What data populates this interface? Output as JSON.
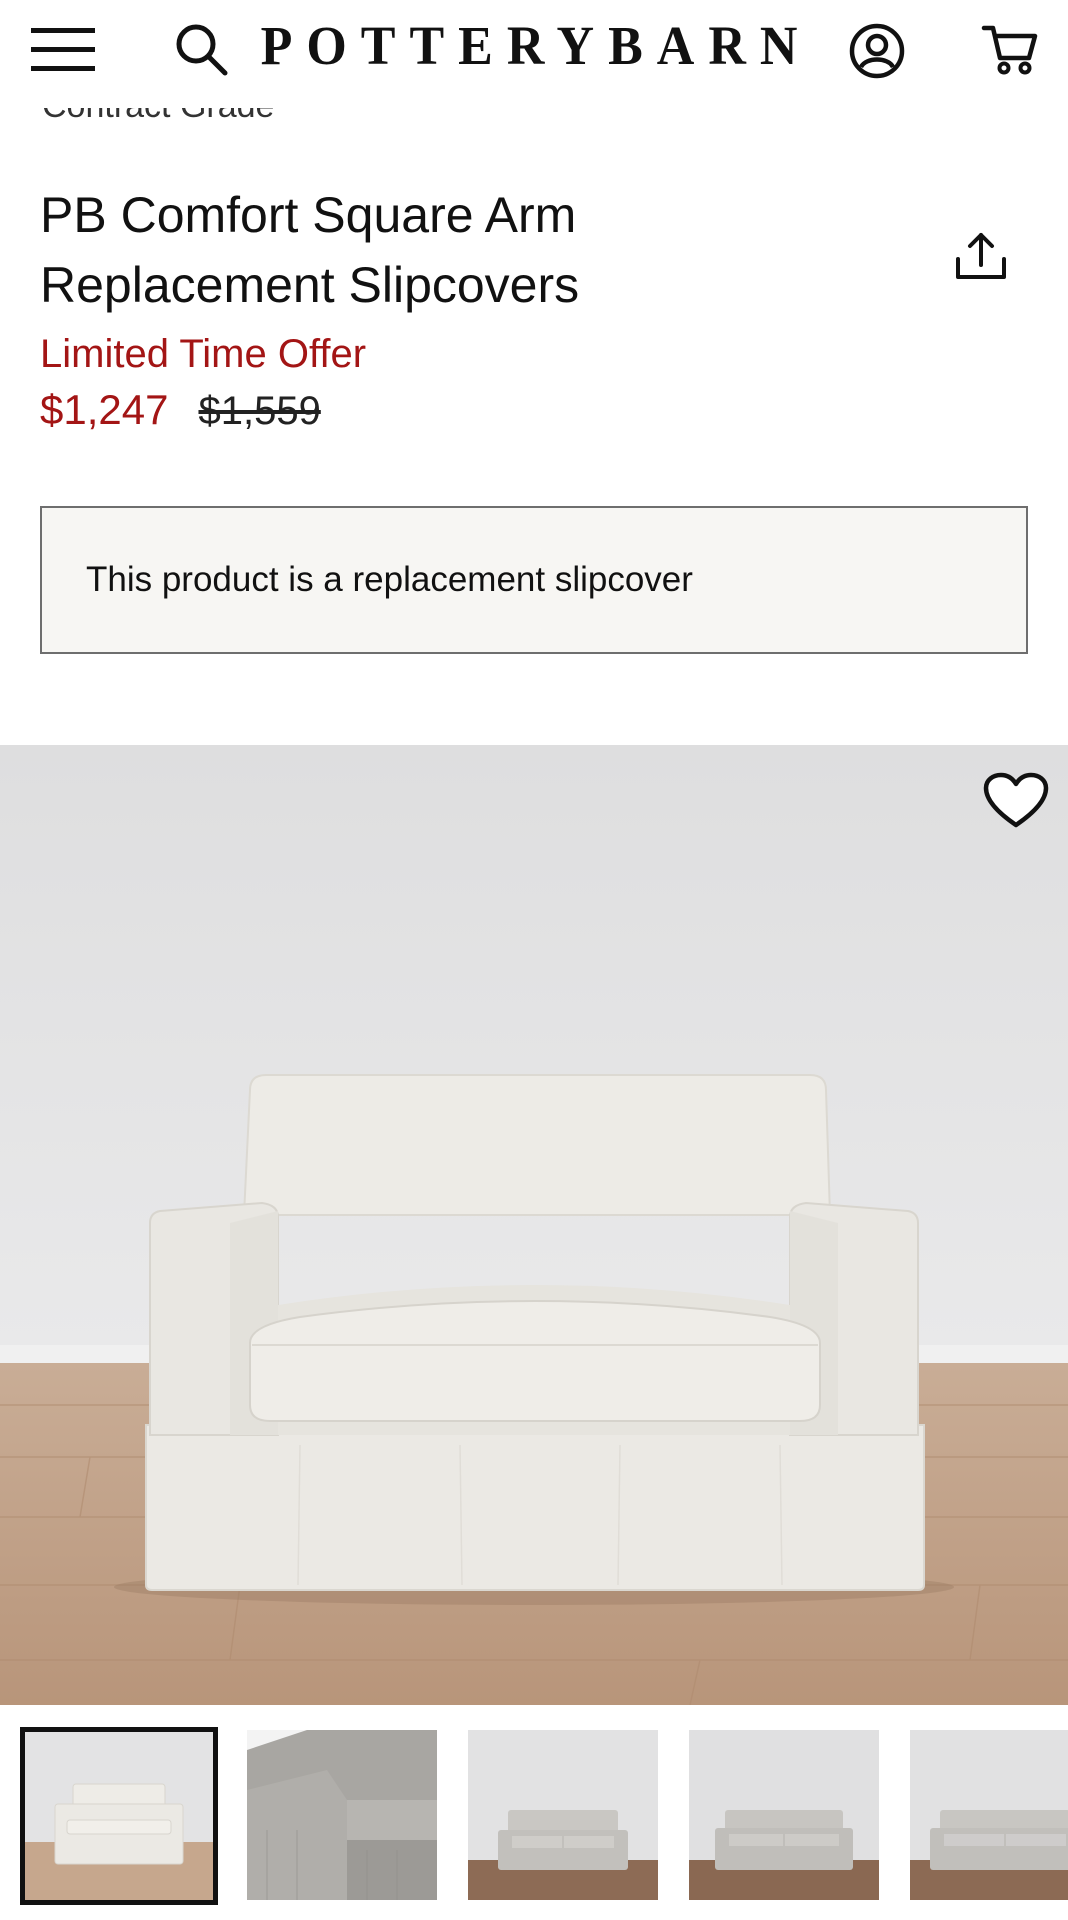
{
  "header": {
    "brand": "POTTERYBARN",
    "icons": [
      "menu-icon",
      "search-icon",
      "account-icon",
      "cart-icon"
    ]
  },
  "breadcrumb_partial": "Contract Grade",
  "product": {
    "title_line1": "PB Comfort Square Arm",
    "title_line2": "Replacement Slipcovers",
    "offer_label": "Limited Time Offer",
    "sale_price": "$1,247",
    "original_price": "$1,559",
    "notice": "This product is a replacement slipcover"
  },
  "gallery": {
    "selected_index": 0,
    "thumbnails": [
      "armchair front view",
      "fabric arm detail",
      "loveseat front view",
      "loveseat front view",
      "loveseat front view"
    ]
  },
  "colors": {
    "sale_red": "#a31515",
    "notice_bg": "#f7f6f3",
    "notice_border": "#6e6e6e"
  }
}
